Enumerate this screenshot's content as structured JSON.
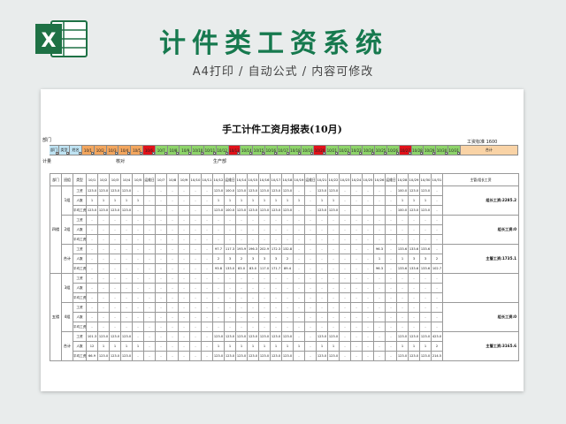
{
  "banner": {
    "title": "计件类工资系统",
    "subtitle": "A4打印 / 自动公式 / 内容可修改",
    "logo_letter": "X"
  },
  "sheet": {
    "title": "手工计件工资月报表(10月)",
    "top_left_label": "部门",
    "wage_label": "工资标准 1600",
    "row3": {
      "left": "计量",
      "mid1": "核对",
      "mid2": "生产部"
    },
    "header_row": {
      "first_cells": [
        "部门",
        "类型",
        "姓名"
      ],
      "dates": [
        "10/1",
        "10/2",
        "10/3",
        "10/4",
        "10/5",
        "10/6",
        "10/7",
        "10/8",
        "10/9",
        "10/10",
        "10/11",
        "10/12",
        "10/13",
        "10/14",
        "10/15",
        "10/16",
        "10/17",
        "10/18",
        "10/19",
        "10/20",
        "10/21",
        "10/22",
        "10/23",
        "10/24",
        "10/25",
        "10/26",
        "10/27",
        "10/28",
        "10/29",
        "10/30",
        "10/31"
      ],
      "total": "合计",
      "colors": {
        "blue": "#bfe3f3",
        "orange": "#f3a65e",
        "green": "#8ed46a",
        "red": "#e2121a",
        "peach": "#f9d3a6"
      }
    },
    "table": {
      "head": [
        "部门",
        "班组",
        "类型",
        "10/1",
        "10/2",
        "10/3",
        "10/4",
        "10/5",
        "运维日",
        "10/7",
        "10/8",
        "10/9",
        "10/10",
        "10/11",
        "10/12",
        "运维日",
        "10/14",
        "10/15",
        "10/16",
        "10/17",
        "10/18",
        "10/19",
        "运维日",
        "10/21",
        "10/22",
        "10/23",
        "10/24",
        "10/25",
        "10/26",
        "运维日",
        "10/28",
        "10/29",
        "10/30",
        "10/31",
        "主管/组长工资"
      ],
      "types": [
        "工资",
        "人数",
        "平均工资"
      ],
      "groups": [
        {
          "dept": "四楼",
          "shift": "1组",
          "rows": [
            [
              "123.0",
              "123.0",
              "123.0",
              "123.0",
              "-",
              "-",
              "-",
              "-",
              "-",
              "-",
              "-",
              "123.0",
              "100.0",
              "123.0",
              "123.0",
              "123.0",
              "123.0",
              "123.0",
              "-",
              "-",
              "123.0",
              "123.0",
              "-",
              "-",
              "-",
              "-",
              "-",
              "100.0",
              "123.0",
              "123.0",
              "-"
            ],
            [
              "1",
              "1",
              "1",
              "1",
              "1",
              "-",
              "-",
              "-",
              "-",
              "-",
              "-",
              "1",
              "1",
              "1",
              "1",
              "1",
              "1",
              "1",
              "1",
              "-",
              "1",
              "1",
              "-",
              "-",
              "-",
              "-",
              "-",
              "1",
              "1",
              "1",
              "-"
            ],
            [
              "123.0",
              "123.0",
              "123.0",
              "123.0",
              "-",
              "-",
              "-",
              "-",
              "-",
              "-",
              "-",
              "123.0",
              "100.0",
              "123.0",
              "123.0",
              "123.0",
              "123.0",
              "123.0",
              "-",
              "-",
              "123.0",
              "123.0",
              "-",
              "-",
              "-",
              "-",
              "-",
              "100.0",
              "123.0",
              "123.0",
              "-"
            ]
          ],
          "note": "组长工资:2285.2"
        },
        {
          "dept": "",
          "shift": "2组",
          "rows": [
            [
              "-",
              "-",
              "-",
              "-",
              "-",
              "-",
              "-",
              "-",
              "-",
              "-",
              "-",
              "-",
              "-",
              "-",
              "-",
              "-",
              "-",
              "-",
              "-",
              "-",
              "-",
              "-",
              "-",
              "-",
              "-",
              "-",
              "-",
              "-",
              "-",
              "-",
              "-"
            ],
            [
              "-",
              "-",
              "-",
              "-",
              "-",
              "-",
              "-",
              "-",
              "-",
              "-",
              "-",
              "-",
              "-",
              "-",
              "-",
              "-",
              "-",
              "-",
              "-",
              "-",
              "-",
              "-",
              "-",
              "-",
              "-",
              "-",
              "-",
              "-",
              "-",
              "-",
              "-"
            ],
            [
              "-",
              "-",
              "-",
              "-",
              "-",
              "-",
              "-",
              "-",
              "-",
              "-",
              "-",
              "-",
              "-",
              "-",
              "-",
              "-",
              "-",
              "-",
              "-",
              "-",
              "-",
              "-",
              "-",
              "-",
              "-",
              "-",
              "-",
              "-",
              "-",
              "-",
              "-"
            ]
          ],
          "note": "组长工资:0"
        },
        {
          "dept": "",
          "shift": "合计",
          "rows": [
            [
              "-",
              "-",
              "-",
              "-",
              "-",
              "-",
              "-",
              "-",
              "-",
              "-",
              "-",
              "97.7",
              "117.3",
              "193.9",
              "196.3",
              "202.9",
              "172.3",
              "132.8",
              "-",
              "-",
              "-",
              "-",
              "-",
              "-",
              "-",
              "96.3",
              "-",
              "133.6",
              "133.6",
              "133.6",
              "-"
            ],
            [
              "-",
              "-",
              "-",
              "-",
              "-",
              "-",
              "-",
              "-",
              "-",
              "-",
              "-",
              "2",
              "3",
              "2",
              "3",
              "3",
              "3",
              "2",
              "-",
              "-",
              "-",
              "-",
              "-",
              "-",
              "-",
              "1",
              "-",
              "1",
              "3",
              "3",
              "2"
            ],
            [
              "-",
              "-",
              "-",
              "-",
              "-",
              "-",
              "-",
              "-",
              "-",
              "-",
              "-",
              "93.8",
              "133.0",
              "83.0",
              "83.0",
              "117.0",
              "171.7",
              "89.4",
              "-",
              "-",
              "-",
              "-",
              "-",
              "-",
              "-",
              "96.3",
              "-",
              "133.6",
              "133.6",
              "133.6",
              "102.7"
            ]
          ],
          "note": "主管工资:1735.1"
        },
        {
          "dept": "五楼",
          "shift": "3组",
          "rows": [
            [
              "-",
              "-",
              "-",
              "-",
              "-",
              "-",
              "-",
              "-",
              "-",
              "-",
              "-",
              "-",
              "-",
              "-",
              "-",
              "-",
              "-",
              "-",
              "-",
              "-",
              "-",
              "-",
              "-",
              "-",
              "-",
              "-",
              "-",
              "-",
              "-",
              "-",
              "-"
            ],
            [
              "-",
              "-",
              "-",
              "-",
              "-",
              "-",
              "-",
              "-",
              "-",
              "-",
              "-",
              "-",
              "-",
              "-",
              "-",
              "-",
              "-",
              "-",
              "-",
              "-",
              "-",
              "-",
              "-",
              "-",
              "-",
              "-",
              "-",
              "-",
              "-",
              "-",
              "-"
            ],
            [
              "-",
              "-",
              "-",
              "-",
              "-",
              "-",
              "-",
              "-",
              "-",
              "-",
              "-",
              "-",
              "-",
              "-",
              "-",
              "-",
              "-",
              "-",
              "-",
              "-",
              "-",
              "-",
              "-",
              "-",
              "-",
              "-",
              "-",
              "-",
              "-",
              "-",
              "-"
            ]
          ],
          "note": ""
        },
        {
          "dept": "",
          "shift": "4组",
          "rows": [
            [
              "-",
              "-",
              "-",
              "-",
              "-",
              "-",
              "-",
              "-",
              "-",
              "-",
              "-",
              "-",
              "-",
              "-",
              "-",
              "-",
              "-",
              "-",
              "-",
              "-",
              "-",
              "-",
              "-",
              "-",
              "-",
              "-",
              "-",
              "-",
              "-",
              "-",
              "-"
            ],
            [
              "-",
              "-",
              "-",
              "-",
              "-",
              "-",
              "-",
              "-",
              "-",
              "-",
              "-",
              "-",
              "-",
              "-",
              "-",
              "-",
              "-",
              "-",
              "-",
              "-",
              "-",
              "-",
              "-",
              "-",
              "-",
              "-",
              "-",
              "-",
              "-",
              "-",
              "-"
            ],
            [
              "-",
              "-",
              "-",
              "-",
              "-",
              "-",
              "-",
              "-",
              "-",
              "-",
              "-",
              "-",
              "-",
              "-",
              "-",
              "-",
              "-",
              "-",
              "-",
              "-",
              "-",
              "-",
              "-",
              "-",
              "-",
              "-",
              "-",
              "-",
              "-",
              "-",
              "-"
            ]
          ],
          "note": "组长工资:0"
        },
        {
          "dept": "",
          "shift": "合计",
          "rows": [
            [
              "101.3",
              "123.0",
              "123.0",
              "123.0",
              "-",
              "-",
              "-",
              "-",
              "-",
              "-",
              "-",
              "123.0",
              "123.0",
              "123.0",
              "123.0",
              "123.0",
              "123.0",
              "123.0",
              "-",
              "-",
              "123.0",
              "123.0",
              "-",
              "-",
              "-",
              "-",
              "-",
              "123.0",
              "123.0",
              "123.0",
              "423.0"
            ],
            [
              "12",
              "1",
              "1",
              "1",
              "1",
              "-",
              "-",
              "-",
              "-",
              "-",
              "-",
              "1",
              "1",
              "1",
              "1",
              "1",
              "1",
              "1",
              "1",
              "-",
              "1",
              "1",
              "-",
              "-",
              "-",
              "-",
              "-",
              "1",
              "1",
              "1",
              "2"
            ],
            [
              "66.9",
              "123.0",
              "123.0",
              "123.0",
              "-",
              "-",
              "-",
              "-",
              "-",
              "-",
              "-",
              "123.0",
              "123.0",
              "123.0",
              "123.0",
              "123.0",
              "123.0",
              "123.0",
              "-",
              "-",
              "123.0",
              "123.0",
              "-",
              "-",
              "-",
              "-",
              "-",
              "123.0",
              "123.0",
              "123.0",
              "214.5"
            ]
          ],
          "note": "主管工资:3165.6"
        }
      ]
    }
  }
}
